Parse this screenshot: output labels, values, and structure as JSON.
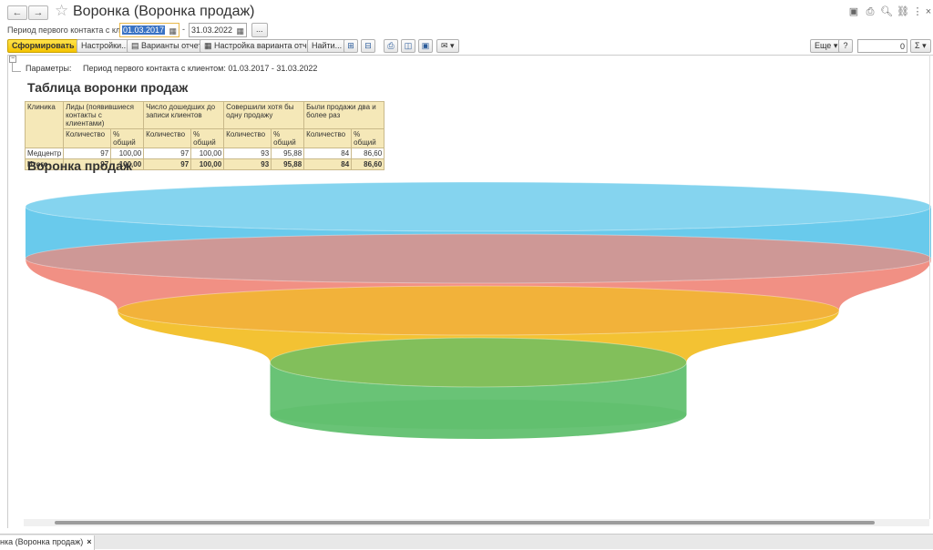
{
  "header": {
    "title": "Воронка (Воронка продаж)",
    "back": "←",
    "forward": "→",
    "star": "☆"
  },
  "period": {
    "label": "Период первого контакта с клиентом:",
    "from": "01.03.2017",
    "dash": "-",
    "to": "31.03.2022",
    "more": "..."
  },
  "toolbar": {
    "generate": "Сформировать",
    "settings": "Настройки...",
    "variants": "Варианты отчета",
    "variant_settings": "Настройка варианта отчета",
    "find": "Найти...",
    "more": "Еще",
    "help": "?",
    "sum_value": "0",
    "sum": "Σ"
  },
  "report": {
    "params_label": "Параметры:",
    "params_value": "Период первого контакта с клиентом: 01.03.2017 - 31.03.2022",
    "table_title": "Таблица воронки продаж",
    "chart_title": "Воронка продаж",
    "table": {
      "col_clinic": "Клиника",
      "groups": [
        "Лиды (появившиеся контакты с клиентами)",
        "Число дошедших до записи клиентов",
        "Совершили хотя бы одну продажу",
        "Были продажи два и более раз"
      ],
      "sub_count": "Количество",
      "sub_pct": "% общий",
      "rows": [
        {
          "name": "Медцентр",
          "v": [
            "97",
            "100,00",
            "97",
            "100,00",
            "93",
            "95,88",
            "84",
            "86,60"
          ]
        }
      ],
      "total": {
        "name": "Итого",
        "v": [
          "97",
          "100,00",
          "97",
          "100,00",
          "93",
          "95,88",
          "84",
          "86,60"
        ]
      }
    }
  },
  "chart_data": {
    "type": "funnel",
    "title": "Воронка продаж",
    "categories": [
      "Лиды (появившиеся контакты с клиентами)",
      "Число дошедших до записи клиентов",
      "Совершили хотя бы одну продажу",
      "Были продажи два и более раз"
    ],
    "values": [
      97,
      97,
      93,
      84
    ],
    "colors": [
      "#5cc6ea",
      "#f0877a",
      "#f2bd22",
      "#5cbe6a"
    ]
  },
  "tab": {
    "label": "нка (Воронка продаж)",
    "close": "×"
  }
}
